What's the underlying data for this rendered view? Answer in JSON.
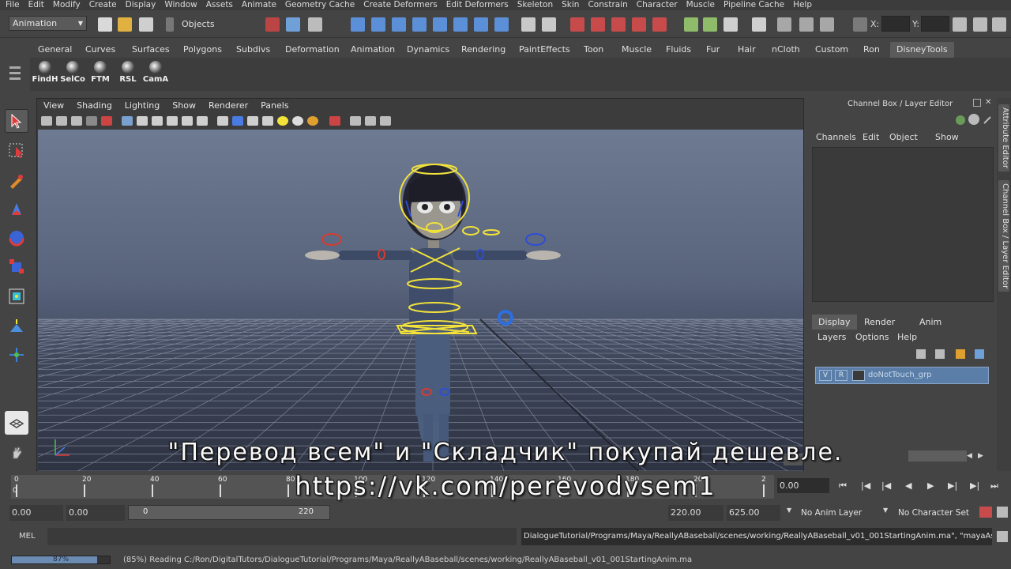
{
  "menubar": [
    "File",
    "Edit",
    "Modify",
    "Create",
    "Display",
    "Window",
    "Assets",
    "Animate",
    "Geometry Cache",
    "Create Deformers",
    "Edit Deformers",
    "Skeleton",
    "Skin",
    "Constrain",
    "Character",
    "Muscle",
    "Pipeline Cache",
    "Help"
  ],
  "status_line": {
    "mode": "Animation",
    "objects_label": "Objects",
    "x_label": "X:",
    "y_label": "Y:"
  },
  "shelf_tabs": [
    "General",
    "Curves",
    "Surfaces",
    "Polygons",
    "Subdivs",
    "Deformation",
    "Animation",
    "Dynamics",
    "Rendering",
    "PaintEffects",
    "Toon",
    "Muscle",
    "Fluids",
    "Fur",
    "Hair",
    "nCloth",
    "Custom",
    "Ron",
    "DisneyTools"
  ],
  "shelf_active": "DisneyTools",
  "shelf_buttons": [
    "FindH",
    "SelCo",
    "FTM",
    "RSL",
    "CamA"
  ],
  "viewport": {
    "menu": [
      "View",
      "Shading",
      "Lighting",
      "Show",
      "Renderer",
      "Panels"
    ]
  },
  "channel_box": {
    "title": "Channel Box / Layer Editor",
    "menu": [
      "Channels",
      "Edit",
      "Object",
      "Show"
    ]
  },
  "side_tabs": [
    "Attribute Editor",
    "Channel Box / Layer Editor"
  ],
  "layer_editor": {
    "tabs": [
      "Display",
      "Render",
      "Anim"
    ],
    "active_tab": "Display",
    "menu": [
      "Layers",
      "Options",
      "Help"
    ],
    "layers": [
      {
        "visible": "V",
        "reference": "R",
        "name": "doNotTouch_grp"
      }
    ]
  },
  "timeline": {
    "ticks": [
      "0",
      "20",
      "40",
      "60",
      "80",
      "100",
      "120",
      "140",
      "160",
      "180",
      "200",
      "2"
    ],
    "current_frame": "0.00",
    "current_frame_value": 0,
    "start_label": "0"
  },
  "range": {
    "start_time": "0.00",
    "start_playback": "0.00",
    "slider_start": "0",
    "slider_end": "220",
    "end_playback": "220.00",
    "end_time": "625.00",
    "anim_layer": "No Anim Layer",
    "character_set": "No Character Set"
  },
  "command_line": {
    "label": "MEL",
    "result": "DialogueTutorial/Programs/Maya/ReallyABaseball/scenes/working/ReallyABaseball_v01_001StartingAnim.ma\", \"mayaAscii\");"
  },
  "help_line": {
    "progress_label": "87%",
    "progress_value": 0.87,
    "text": "(85%) Reading C:/Ron/DigitalTutors/DialogueTutorial/Programs/Maya/ReallyABaseball/scenes/working/ReallyABaseball_v01_001StartingAnim.ma"
  },
  "overlay": {
    "line1": "\"Перевод всем\" и \"Складчик\" покупай дешевле.",
    "line2": "https://vk.com/perevodvsem1"
  },
  "colors": {
    "accent_blue": "#5a7ea8",
    "rig_yellow": "#f2e23a",
    "rig_blue": "#2d4dd6",
    "rig_red": "#d63b30"
  }
}
